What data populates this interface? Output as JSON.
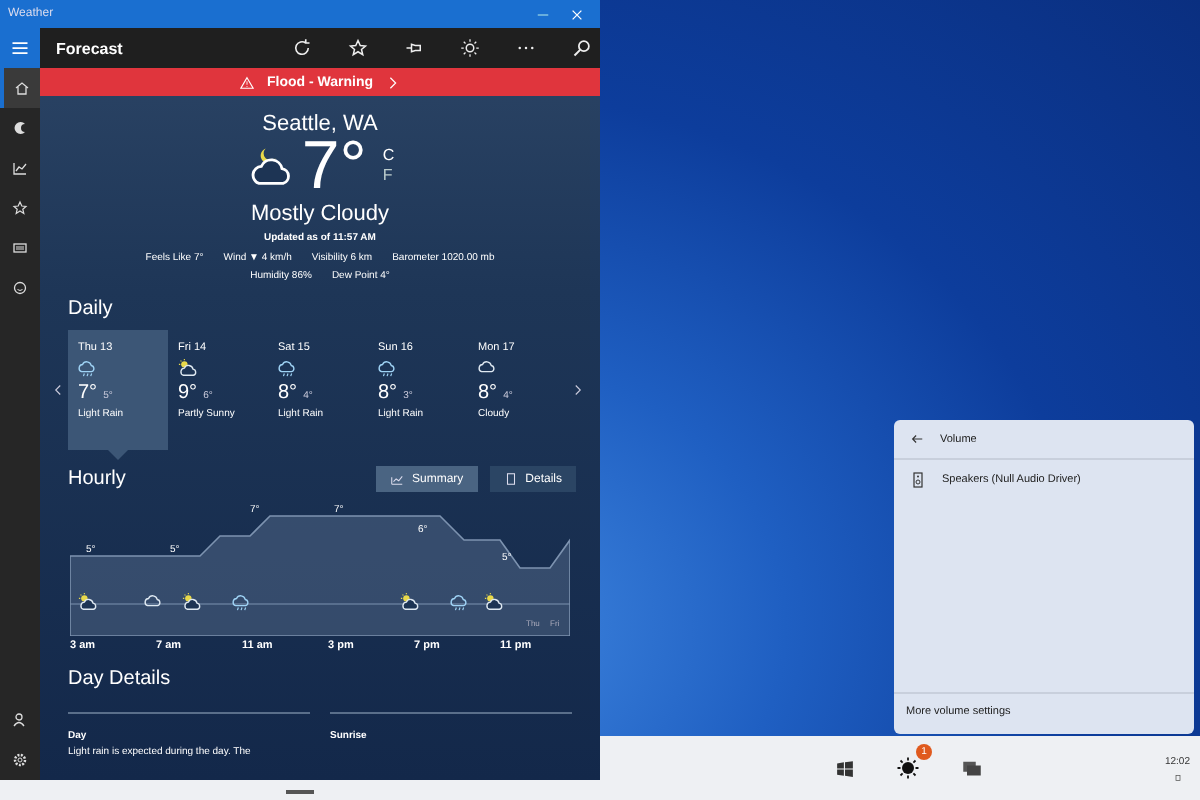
{
  "window": {
    "title": "Weather"
  },
  "app_bar": {
    "title": "Forecast"
  },
  "nav_items": [
    {
      "kind": "home",
      "selected": true
    },
    {
      "kind": "maps",
      "selected": false
    },
    {
      "kind": "history",
      "selected": false
    },
    {
      "kind": "places",
      "selected": false
    },
    {
      "kind": "news",
      "selected": false
    },
    {
      "kind": "feedback",
      "selected": false
    }
  ],
  "nav_bottom": [
    {
      "kind": "account",
      "selected": false
    },
    {
      "kind": "settings",
      "selected": false
    }
  ],
  "alert": {
    "label": "Flood - Warning"
  },
  "current": {
    "location": "Seattle, WA",
    "temperature": "7°",
    "unit_c": "C",
    "unit_f": "F",
    "condition": "Mostly Cloudy",
    "updated": "Updated as of 11:57 AM",
    "details": [
      {
        "label": "Feels Like",
        "value": "7°"
      },
      {
        "label": "Wind",
        "value": "▼ 4 km/h"
      },
      {
        "label": "Visibility",
        "value": "6 km"
      },
      {
        "label": "Barometer",
        "value": "1020.00 mb"
      },
      {
        "label": "Humidity",
        "value": "86%"
      },
      {
        "label": "Dew Point",
        "value": "4°"
      }
    ]
  },
  "daily": {
    "heading": "Daily",
    "days": [
      {
        "day": "Thu 13",
        "high": "7°",
        "low": "5°",
        "condition": "Light Rain",
        "kind": "rain",
        "selected": true
      },
      {
        "day": "Fri 14",
        "high": "9°",
        "low": "6°",
        "condition": "Partly Sunny",
        "kind": "partly-sunny",
        "selected": false
      },
      {
        "day": "Sat 15",
        "high": "8°",
        "low": "4°",
        "condition": "Light Rain",
        "kind": "rain",
        "selected": false
      },
      {
        "day": "Sun 16",
        "high": "8°",
        "low": "3°",
        "condition": "Light Rain",
        "kind": "rain",
        "selected": false
      },
      {
        "day": "Mon 17",
        "high": "8°",
        "low": "4°",
        "condition": "Cloudy",
        "kind": "cloudy",
        "selected": false
      }
    ]
  },
  "hourly": {
    "heading": "Hourly",
    "views": [
      {
        "label": "Summary",
        "kind": "chart",
        "selected": true
      },
      {
        "label": "Details",
        "kind": "list",
        "selected": false
      }
    ],
    "temps": [
      "5°",
      "5°",
      "7°",
      "7°",
      "6°",
      "5°"
    ],
    "icons": [
      {
        "kind": "partly-sunny"
      },
      {
        "kind": "cloudy"
      },
      {
        "kind": "partly-sunny"
      },
      {
        "kind": "rain"
      },
      {
        "kind": "partly-sunny"
      },
      {
        "kind": "rain"
      },
      {
        "kind": "partly-sunny"
      }
    ],
    "times": [
      "3 am",
      "7 am",
      "11 am",
      "3 pm",
      "7 pm",
      "11 pm"
    ],
    "day_labels": [
      "Thu",
      "Fri"
    ]
  },
  "day_details": {
    "heading": "Day Details",
    "day_heading": "Day",
    "day_text": "Light rain is expected during the day. The",
    "sunrise_heading": "Sunrise"
  },
  "volume_flyout": {
    "title": "Volume",
    "device": "Speakers (Null Audio Driver)",
    "link": "More volume settings"
  },
  "taskbar": {
    "badge": "1",
    "time": "12:02"
  }
}
